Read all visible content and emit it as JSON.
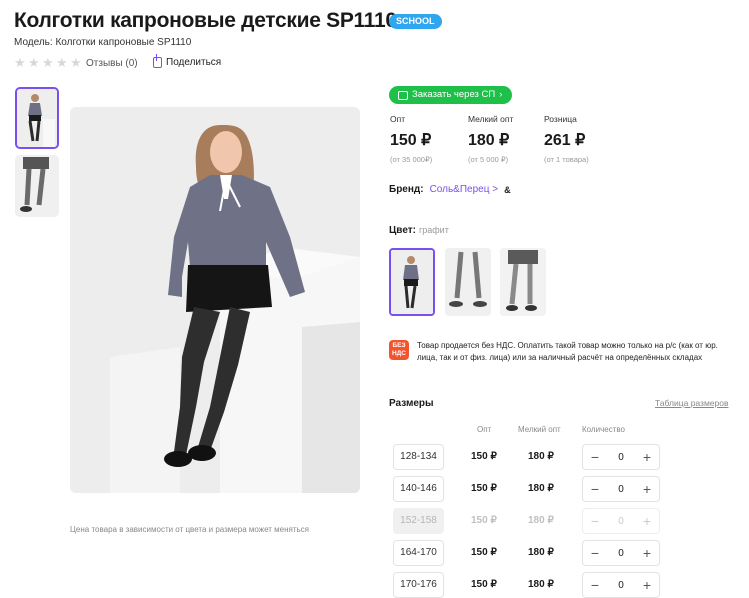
{
  "product": {
    "title": "Колготки капроновые детские SP1110",
    "badge": "SCHOOL",
    "model": "Модель: Колготки капроновые SP1110",
    "reviews": "Отзывы (0)",
    "share": "Поделиться",
    "price_note": "Цена товара в зависимости от цвета и размера может меняться"
  },
  "order": {
    "button": "Заказать через СП",
    "arrow": "›"
  },
  "prices": [
    {
      "label": "Опт",
      "value": "150 ₽",
      "note": "(от 35 000₽)"
    },
    {
      "label": "Мелкий опт",
      "value": "180 ₽",
      "note": "(от 5 000 ₽)"
    },
    {
      "label": "Розница",
      "value": "261 ₽",
      "note": "(от 1 товара)"
    }
  ],
  "brand": {
    "label": "Бренд:",
    "name": "Соль&Перец",
    "arrow": ">",
    "logo": "&"
  },
  "color": {
    "label": "Цвет:",
    "value": "графит"
  },
  "vat": {
    "icon_text": "БЕЗ НДС",
    "text": "Товар продается без НДС. Оплатить такой товар можно только на р/с (как от юр. лица, так и от физ. лица) или за наличный расчёт на определённых складах"
  },
  "sizes": {
    "title": "Размеры",
    "table_link": "Таблица размеров",
    "headers": {
      "opt": "Опт",
      "small_opt": "Мелкий опт",
      "qty": "Количество"
    },
    "minus": "−",
    "plus": "+",
    "rows": [
      {
        "size": "128-134",
        "opt": "150 ₽",
        "small": "180 ₽",
        "qty": "0"
      },
      {
        "size": "140-146",
        "opt": "150 ₽",
        "small": "180 ₽",
        "qty": "0"
      },
      {
        "size": "152-158",
        "opt": "150 ₽",
        "small": "180 ₽",
        "qty": "0"
      },
      {
        "size": "164-170",
        "opt": "150 ₽",
        "small": "180 ₽",
        "qty": "0"
      },
      {
        "size": "170-176",
        "opt": "150 ₽",
        "small": "180 ₽",
        "qty": "0"
      }
    ]
  },
  "colors": {
    "accent": "#7a4ff0",
    "green": "#1fc04a",
    "badge": "#2ea6f0",
    "vat": "#f2542d"
  }
}
